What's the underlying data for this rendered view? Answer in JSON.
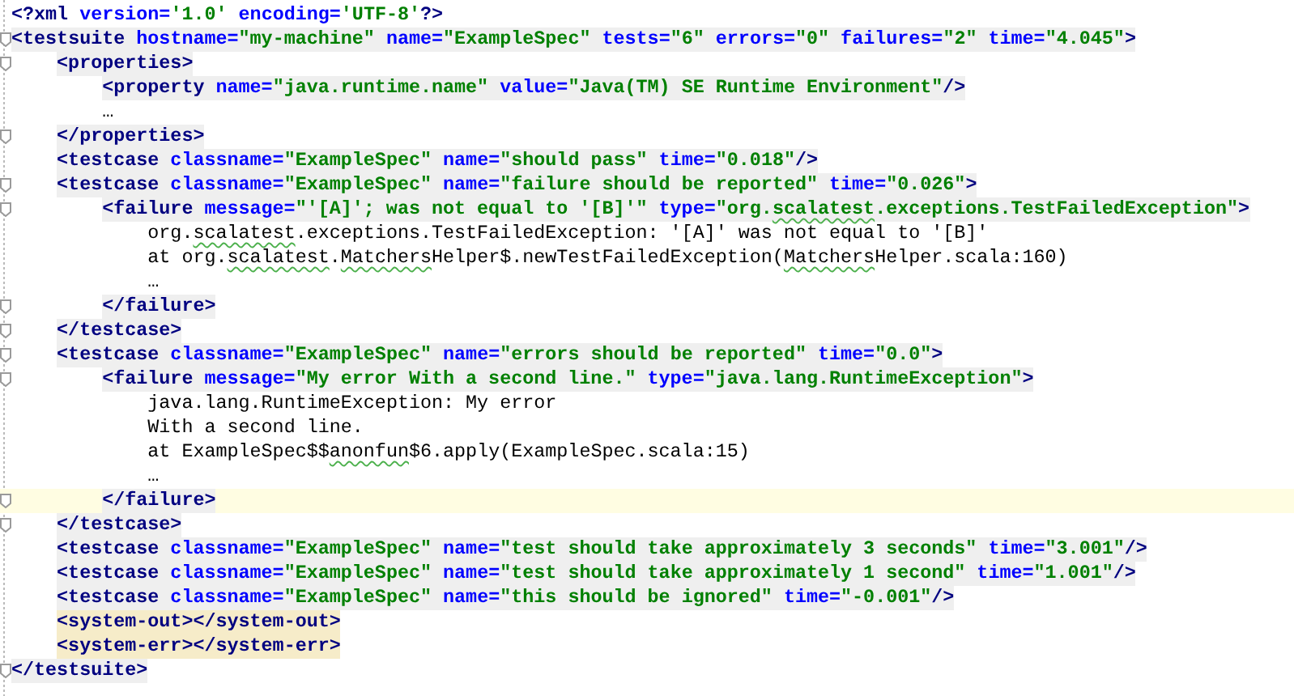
{
  "lines": [
    {
      "tokens": [
        {
          "kind": "tag",
          "text": "<?xml"
        },
        {
          "kind": "attr",
          "text": " version="
        },
        {
          "kind": "value",
          "text": "'1.0'"
        },
        {
          "kind": "attr",
          "text": " encoding="
        },
        {
          "kind": "value",
          "text": "'UTF-8'"
        },
        {
          "kind": "tag",
          "text": "?>"
        }
      ]
    },
    {
      "highlighted": true,
      "fold": true,
      "tokens": [
        {
          "kind": "tag",
          "text": "<testsuite"
        },
        {
          "kind": "attr",
          "text": " hostname="
        },
        {
          "kind": "value",
          "text": "\"my-machine\""
        },
        {
          "kind": "attr",
          "text": " name="
        },
        {
          "kind": "value",
          "text": "\"ExampleSpec\""
        },
        {
          "kind": "attr",
          "text": " tests="
        },
        {
          "kind": "value",
          "text": "\"6\""
        },
        {
          "kind": "attr",
          "text": " errors="
        },
        {
          "kind": "value",
          "text": "\"0\""
        },
        {
          "kind": "attr",
          "text": " failures="
        },
        {
          "kind": "value",
          "text": "\"2\""
        },
        {
          "kind": "attr",
          "text": " time="
        },
        {
          "kind": "value",
          "text": "\"4.045\""
        },
        {
          "kind": "tag",
          "text": ">"
        }
      ],
      "children": [
        {
          "highlighted": true,
          "fold": true,
          "tokens": [
            {
              "kind": "tag",
              "text": "<properties>"
            }
          ],
          "children": [
            {
              "highlighted": true,
              "tokens": [
                {
                  "kind": "tag",
                  "text": "<property"
                },
                {
                  "kind": "attr",
                  "text": " name="
                },
                {
                  "kind": "value",
                  "text": "\"java.runtime.name\""
                },
                {
                  "kind": "attr",
                  "text": " value="
                },
                {
                  "kind": "value",
                  "text": "\"Java(TM) SE Runtime Environment\""
                },
                {
                  "kind": "tag",
                  "text": "/>"
                }
              ]
            },
            {
              "tokens": [
                {
                  "kind": "text",
                  "text": "…"
                }
              ]
            }
          ]
        },
        {
          "highlighted": true,
          "fold": true,
          "tokens": [
            {
              "kind": "tag",
              "text": "</properties>"
            }
          ]
        },
        {
          "highlighted": true,
          "tokens": [
            {
              "kind": "tag",
              "text": "<testcase"
            },
            {
              "kind": "attr",
              "text": " classname="
            },
            {
              "kind": "value",
              "text": "\"ExampleSpec\""
            },
            {
              "kind": "attr",
              "text": " name="
            },
            {
              "kind": "value",
              "text": "\"should pass\""
            },
            {
              "kind": "attr",
              "text": " time="
            },
            {
              "kind": "value",
              "text": "\"0.018\""
            },
            {
              "kind": "tag",
              "text": "/>"
            }
          ]
        },
        {
          "highlighted": true,
          "fold": true,
          "tokens": [
            {
              "kind": "tag",
              "text": "<testcase"
            },
            {
              "kind": "attr",
              "text": " classname="
            },
            {
              "kind": "value",
              "text": "\"ExampleSpec\""
            },
            {
              "kind": "attr",
              "text": " name="
            },
            {
              "kind": "value",
              "text": "\"failure should be reported\""
            },
            {
              "kind": "attr",
              "text": " time="
            },
            {
              "kind": "value",
              "text": "\"0.026\""
            },
            {
              "kind": "tag",
              "text": ">"
            }
          ],
          "children": [
            {
              "highlighted": true,
              "fold": true,
              "tokens": [
                {
                  "kind": "tag",
                  "text": "<failure"
                },
                {
                  "kind": "attr",
                  "text": " message="
                },
                {
                  "kind": "value",
                  "text": "\"'[A]'; was not equal to '[B]'\""
                },
                {
                  "kind": "attr",
                  "text": " type="
                },
                {
                  "kind": "value",
                  "text": "\"org."
                },
                {
                  "kind": "value",
                  "text": "scalatest",
                  "typo": true
                },
                {
                  "kind": "value",
                  "text": ".exceptions.TestFailedException\""
                },
                {
                  "kind": "tag",
                  "text": ">"
                }
              ],
              "children": [
                {
                  "tokens": [
                    {
                      "kind": "text",
                      "text": "org."
                    },
                    {
                      "kind": "text",
                      "text": "scalatest",
                      "typo": true
                    },
                    {
                      "kind": "text",
                      "text": ".exceptions.TestFailedException: '[A]' was not equal to '[B]'"
                    }
                  ]
                },
                {
                  "tokens": [
                    {
                      "kind": "text",
                      "text": "at org."
                    },
                    {
                      "kind": "text",
                      "text": "scalatest",
                      "typo": true
                    },
                    {
                      "kind": "text",
                      "text": "."
                    },
                    {
                      "kind": "text",
                      "text": "Matchers",
                      "typo": true
                    },
                    {
                      "kind": "text",
                      "text": "Helper$.newTestFailedException("
                    },
                    {
                      "kind": "text",
                      "text": "Matchers",
                      "typo": true
                    },
                    {
                      "kind": "text",
                      "text": "Helper.scala:160)"
                    }
                  ]
                },
                {
                  "tokens": [
                    {
                      "kind": "text",
                      "text": "…"
                    }
                  ]
                }
              ]
            },
            {
              "highlighted": true,
              "fold": true,
              "tokens": [
                {
                  "kind": "tag",
                  "text": "</failure>"
                }
              ]
            }
          ]
        },
        {
          "highlighted": true,
          "fold": true,
          "tokens": [
            {
              "kind": "tag",
              "text": "</testcase>"
            }
          ]
        },
        {
          "highlighted": true,
          "fold": true,
          "tokens": [
            {
              "kind": "tag",
              "text": "<testcase"
            },
            {
              "kind": "attr",
              "text": " classname="
            },
            {
              "kind": "value",
              "text": "\"ExampleSpec\""
            },
            {
              "kind": "attr",
              "text": " name="
            },
            {
              "kind": "value",
              "text": "\"errors should be reported\""
            },
            {
              "kind": "attr",
              "text": " time="
            },
            {
              "kind": "value",
              "text": "\"0.0\""
            },
            {
              "kind": "tag",
              "text": ">"
            }
          ],
          "children": [
            {
              "highlighted": true,
              "fold": true,
              "tokens": [
                {
                  "kind": "tag",
                  "text": "<failure"
                },
                {
                  "kind": "attr",
                  "text": " message="
                },
                {
                  "kind": "value",
                  "text": "\"My error With a second line.\""
                },
                {
                  "kind": "attr",
                  "text": " type="
                },
                {
                  "kind": "value",
                  "text": "\"java.lang.RuntimeException\""
                },
                {
                  "kind": "tag",
                  "text": ">"
                }
              ],
              "children": [
                {
                  "tokens": [
                    {
                      "kind": "text",
                      "text": "java.lang.RuntimeException: My error"
                    }
                  ]
                },
                {
                  "tokens": [
                    {
                      "kind": "text",
                      "text": "With a second line."
                    }
                  ]
                },
                {
                  "tokens": [
                    {
                      "kind": "text",
                      "text": "at ExampleSpec$$"
                    },
                    {
                      "kind": "text",
                      "text": "anonfun",
                      "typo": true
                    },
                    {
                      "kind": "text",
                      "text": "$6.apply(ExampleSpec.scala:15)"
                    }
                  ]
                },
                {
                  "tokens": [
                    {
                      "kind": "text",
                      "text": "…"
                    }
                  ]
                }
              ]
            },
            {
              "highlighted": true,
              "fold": true,
              "current": true,
              "tokens": [
                {
                  "kind": "tag",
                  "text": "</failure>"
                }
              ]
            }
          ]
        },
        {
          "highlighted": true,
          "fold": true,
          "tokens": [
            {
              "kind": "tag",
              "text": "</testcase>"
            }
          ]
        },
        {
          "highlighted": true,
          "tokens": [
            {
              "kind": "tag",
              "text": "<testcase"
            },
            {
              "kind": "attr",
              "text": " classname="
            },
            {
              "kind": "value",
              "text": "\"ExampleSpec\""
            },
            {
              "kind": "attr",
              "text": " name="
            },
            {
              "kind": "value",
              "text": "\"test should take approximately 3 seconds\""
            },
            {
              "kind": "attr",
              "text": " time="
            },
            {
              "kind": "value",
              "text": "\"3.001\""
            },
            {
              "kind": "tag",
              "text": "/>"
            }
          ]
        },
        {
          "highlighted": true,
          "tokens": [
            {
              "kind": "tag",
              "text": "<testcase"
            },
            {
              "kind": "attr",
              "text": " classname="
            },
            {
              "kind": "value",
              "text": "\"ExampleSpec\""
            },
            {
              "kind": "attr",
              "text": " name="
            },
            {
              "kind": "value",
              "text": "\"test should take approximately 1 second\""
            },
            {
              "kind": "attr",
              "text": " time="
            },
            {
              "kind": "value",
              "text": "\"1.001\""
            },
            {
              "kind": "tag",
              "text": "/>"
            }
          ]
        },
        {
          "highlighted": true,
          "tokens": [
            {
              "kind": "tag",
              "text": "<testcase"
            },
            {
              "kind": "attr",
              "text": " classname="
            },
            {
              "kind": "value",
              "text": "\"ExampleSpec\""
            },
            {
              "kind": "attr",
              "text": " name="
            },
            {
              "kind": "value",
              "text": "\"this should be ignored\""
            },
            {
              "kind": "attr",
              "text": " time="
            },
            {
              "kind": "value",
              "text": "\"-0.001\""
            },
            {
              "kind": "tag",
              "text": "/>"
            }
          ]
        },
        {
          "matched": true,
          "tokens": [
            {
              "kind": "tag",
              "text": "<system-out></system-out>"
            }
          ]
        },
        {
          "matched": true,
          "tokens": [
            {
              "kind": "tag",
              "text": "<system-err></system-err>"
            }
          ]
        }
      ]
    },
    {
      "highlighted": true,
      "fold": true,
      "tokens": [
        {
          "kind": "tag",
          "text": "</testsuite>"
        }
      ]
    }
  ]
}
